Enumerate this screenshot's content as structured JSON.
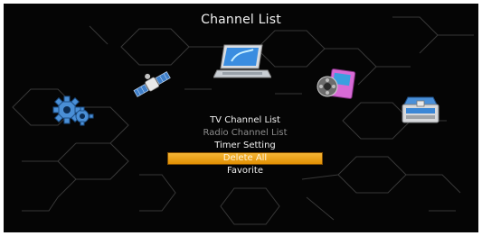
{
  "header": {
    "title": "Channel List"
  },
  "categories": [
    {
      "icon": "gear-icon"
    },
    {
      "icon": "satellite-icon"
    },
    {
      "icon": "laptop-icon"
    },
    {
      "icon": "media-icon"
    },
    {
      "icon": "toolbox-icon"
    }
  ],
  "menu": {
    "items": [
      {
        "label": "TV Channel List"
      },
      {
        "label": "Radio Channel List"
      },
      {
        "label": "Timer Setting"
      },
      {
        "label": "Delete All"
      },
      {
        "label": "Favorite"
      }
    ]
  },
  "colors": {
    "highlight": "#f2a51f",
    "background": "#050505",
    "dim_text": "#8d8d8d"
  }
}
